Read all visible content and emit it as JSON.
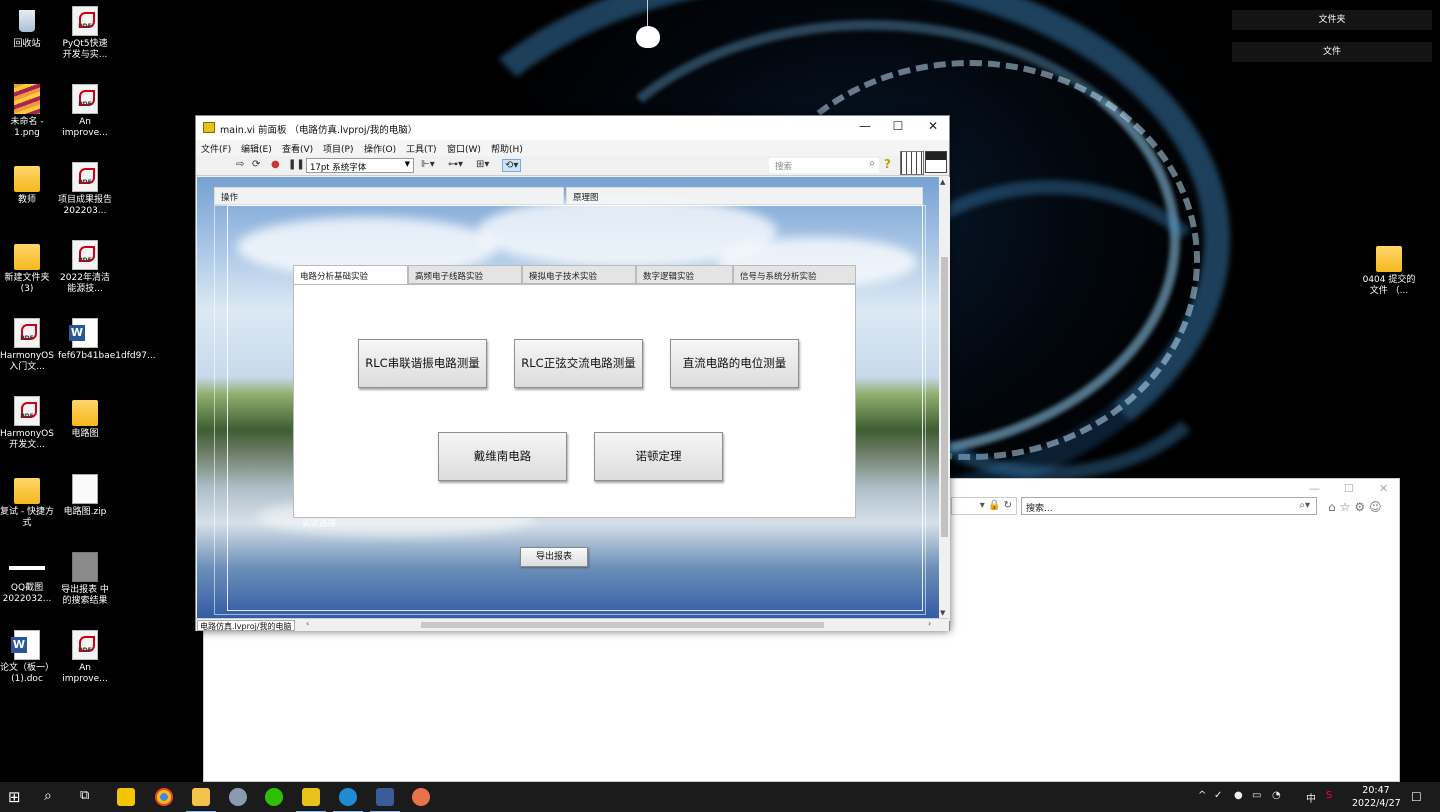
{
  "desktop": {
    "left_icons": [
      {
        "label": "回收站",
        "kind": "bin"
      },
      {
        "label": "PyQt5快速开发与实...",
        "kind": "pdf"
      },
      {
        "label": "未命名 - 1.png",
        "kind": "png"
      },
      {
        "label": "An improve...",
        "kind": "pdf"
      },
      {
        "label": "教师",
        "kind": "folder"
      },
      {
        "label": "项目成果报告202203...",
        "kind": "pdf"
      },
      {
        "label": "新建文件夹 (3)",
        "kind": "folder"
      },
      {
        "label": "2022年清洁能源技...",
        "kind": "pdf"
      },
      {
        "label": "HarmonyOS入门文...",
        "kind": "pdf"
      },
      {
        "label": "fef67b41bae1dfd97...",
        "kind": "word"
      },
      {
        "label": "HarmonyOS开发文...",
        "kind": "pdf"
      },
      {
        "label": "电路图",
        "kind": "folder"
      },
      {
        "label": "复试 - 快捷方式",
        "kind": "folder"
      },
      {
        "label": "电路图.zip",
        "kind": "zip"
      },
      {
        "label": "QQ截图2022032...",
        "kind": "bar"
      },
      {
        "label": "导出报表 中的搜索结果",
        "kind": "gray"
      },
      {
        "label": "论文（板一）(1).doc",
        "kind": "word"
      },
      {
        "label": "An improve...",
        "kind": "pdf"
      }
    ],
    "right_icon": {
      "label": "0404 提交的文件 （...",
      "kind": "folder"
    },
    "right_buttons": [
      "文件夹",
      "文件"
    ]
  },
  "browser": {
    "search_placeholder": "搜索..."
  },
  "labview": {
    "title": "main.vi 前面板 （电路仿真.lvproj/我的电脑）",
    "menu": [
      "文件(F)",
      "编辑(E)",
      "查看(V)",
      "项目(P)",
      "操作(O)",
      "工具(T)",
      "窗口(W)",
      "帮助(H)"
    ],
    "font": "17pt 系统字体",
    "search_placeholder": "搜索",
    "panel": {
      "header_left": "操作",
      "header_right": "原理图",
      "tabs": [
        "电路分析基础实验",
        "高频电子线路实验",
        "模拟电子技术实验",
        "数字逻辑实验",
        "信号与系统分析实验"
      ],
      "active_tab": 0,
      "buttons_row1": [
        "RLC串联谐振电路测量",
        "RLC正弦交流电路测量",
        "直流电路的电位测量"
      ],
      "buttons_row2": [
        "戴维南电路",
        "诺顿定理"
      ],
      "select_label": "实验选择",
      "export_label": "导出报表"
    },
    "status_context": "电路仿真.lvproj/我的电脑"
  },
  "taskbar": {
    "ime": "中",
    "time": "20:47",
    "date": "2022/4/27"
  }
}
